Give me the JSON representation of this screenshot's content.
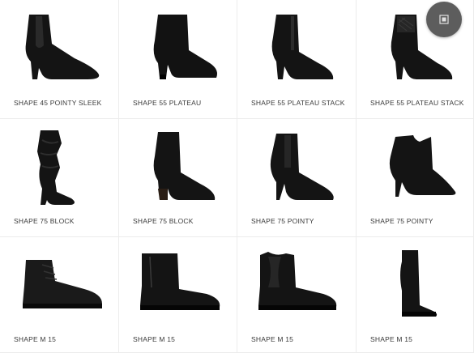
{
  "products": [
    {
      "name": "SHAPE 45 POINTY SLEEK",
      "style": "ankle-heel"
    },
    {
      "name": "SHAPE 55 PLATEAU",
      "style": "suede-block"
    },
    {
      "name": "SHAPE 55 PLATEAU STACK",
      "style": "ankle-heel"
    },
    {
      "name": "SHAPE 55 PLATEAU STACK",
      "style": "quilted-heel"
    },
    {
      "name": "SHAPE 75 BLOCK",
      "style": "slouch-tall"
    },
    {
      "name": "SHAPE 75 BLOCK",
      "style": "ankle-block"
    },
    {
      "name": "SHAPE 75 POINTY",
      "style": "stiletto-ankle"
    },
    {
      "name": "SHAPE 75 POINTY",
      "style": "bootie"
    },
    {
      "name": "SHAPE M 15",
      "style": "suede-lace"
    },
    {
      "name": "SHAPE M 15",
      "style": "flat-ankle"
    },
    {
      "name": "SHAPE M 15",
      "style": "chelsea-flat"
    },
    {
      "name": "SHAPE M 15",
      "style": "knee-flat"
    }
  ],
  "fab": {
    "icon": "compare-icon"
  },
  "colors": {
    "shoe": "#141414",
    "border": "#ececec",
    "label": "#3a3a3a",
    "fab": "#5d5d5d"
  }
}
